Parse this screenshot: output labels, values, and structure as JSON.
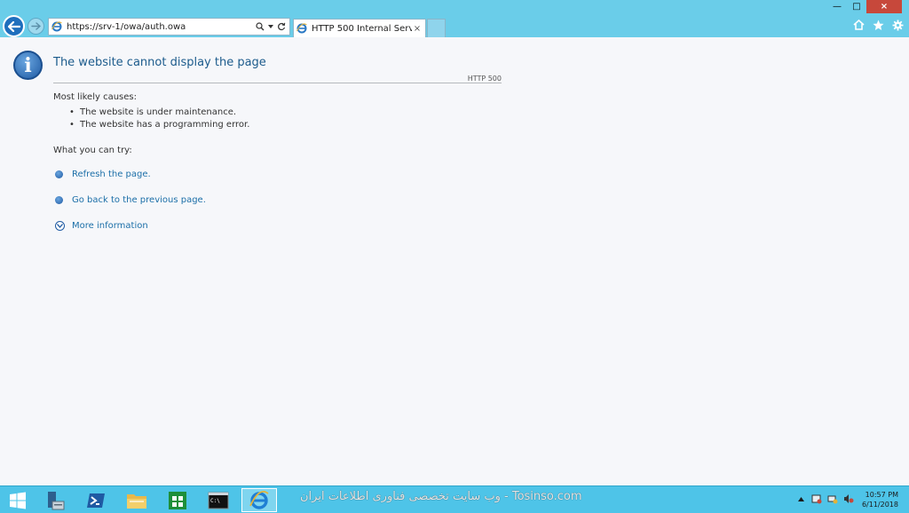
{
  "browser": {
    "url": "https://srv-1/owa/auth.owa",
    "tab_title": "HTTP 500 Internal Server Err...",
    "tab_close": "×",
    "window_controls": {
      "minimize": "—",
      "maximize": "□",
      "close": "×"
    },
    "icons": [
      "back-arrow-icon",
      "forward-arrow-icon",
      "ie-icon",
      "search-icon",
      "dropdown-icon",
      "refresh-icon",
      "home-icon",
      "favorites-star-icon",
      "settings-gear-icon"
    ]
  },
  "page": {
    "title": "The website cannot display the page",
    "http_code": "HTTP 500",
    "causes_label": "Most likely causes:",
    "causes": [
      "The website is under maintenance.",
      "The website has a programming error."
    ],
    "try_label": "What you can try:",
    "actions": [
      "Refresh the page.",
      "Go back to the previous page."
    ],
    "more_info": "More information"
  },
  "taskbar": {
    "watermark": "وب سایت تخصصی فناوری اطلاعات ایران - Tosinso.com",
    "items": [
      "start-icon",
      "server-manager-icon",
      "powershell-icon",
      "file-explorer-icon",
      "store-icon",
      "cmd-icon",
      "ie-icon"
    ],
    "active_item": "ie-icon",
    "clock_time": "10:57 PM",
    "clock_date": "6/11/2018"
  },
  "colors": {
    "chrome_bg": "#6acde9",
    "taskbar_bg": "#4ec4e8",
    "link": "#1c6fa8",
    "title": "#1c5b8c"
  }
}
